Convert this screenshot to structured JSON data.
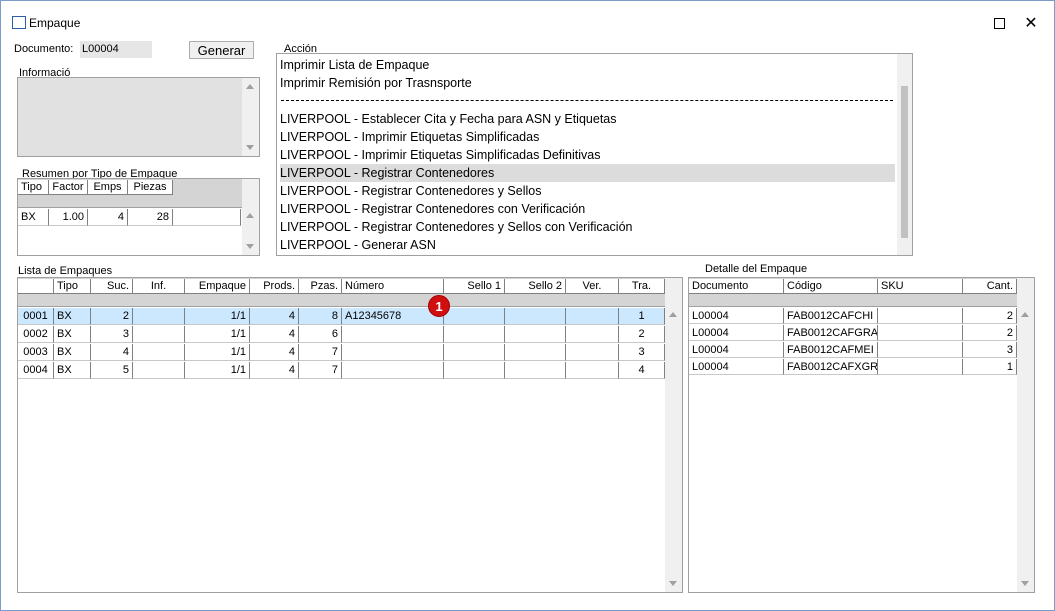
{
  "window": {
    "title": "Empaque"
  },
  "documento": {
    "label": "Documento:",
    "value": "L00004"
  },
  "generar_label": "Generar",
  "informacion_label": "Informació",
  "accion": {
    "label": "Acción",
    "items": [
      "Imprimir Lista de Empaque",
      "Imprimir Remisión por Trasnsporte",
      "LIVERPOOL - Establecer Cita y Fecha para ASN y Etiquetas",
      "LIVERPOOL - Imprimir Etiquetas Simplificadas",
      "LIVERPOOL - Imprimir Etiquetas Simplificadas Definitivas",
      "LIVERPOOL - Registrar Contenedores",
      "LIVERPOOL - Registrar Contenedores y Sellos",
      "LIVERPOOL - Registrar Contenedores con Verificación",
      "LIVERPOOL - Registrar Contenedores y Sellos con Verificación",
      "LIVERPOOL - Generar ASN"
    ]
  },
  "resumen": {
    "label": "Resumen por Tipo de Empaque",
    "headers": [
      "Tipo",
      "Factor",
      "Emps",
      "Piezas"
    ],
    "rows": [
      [
        "BX",
        "1.00",
        "4",
        "28"
      ]
    ]
  },
  "lista": {
    "label": "Lista de Empaques",
    "headers": [
      "Tipo",
      "Suc.",
      "Inf.",
      "Empaque",
      "Prods.",
      "Pzas.",
      "Número",
      "Sello 1",
      "Sello 2",
      "Ver.",
      "Tra."
    ],
    "rows": [
      [
        "0001",
        "BX",
        "2",
        "",
        "1/1",
        "4",
        "8",
        "A12345678",
        "",
        "",
        "",
        "1"
      ],
      [
        "0002",
        "BX",
        "3",
        "",
        "1/1",
        "4",
        "6",
        "",
        "",
        "",
        "",
        "2"
      ],
      [
        "0003",
        "BX",
        "4",
        "",
        "1/1",
        "4",
        "7",
        "",
        "",
        "",
        "",
        "3"
      ],
      [
        "0004",
        "BX",
        "5",
        "",
        "1/1",
        "4",
        "7",
        "",
        "",
        "",
        "",
        "4"
      ]
    ]
  },
  "detalle": {
    "label": "Detalle del Empaque",
    "headers": [
      "Documento",
      "Código",
      "SKU",
      "Cant."
    ],
    "rows": [
      [
        "L00004",
        "FAB0012CAFCHI",
        "",
        "2"
      ],
      [
        "L00004",
        "FAB0012CAFGRA",
        "",
        "2"
      ],
      [
        "L00004",
        "FAB0012CAFMEI",
        "",
        "3"
      ],
      [
        "L00004",
        "FAB0012CAFXGR",
        "",
        "1"
      ]
    ]
  },
  "badge": "1",
  "colors": {
    "selected_row": "#cce8ff",
    "selected_action": "#dcdcdc",
    "badge": "#d01010"
  }
}
